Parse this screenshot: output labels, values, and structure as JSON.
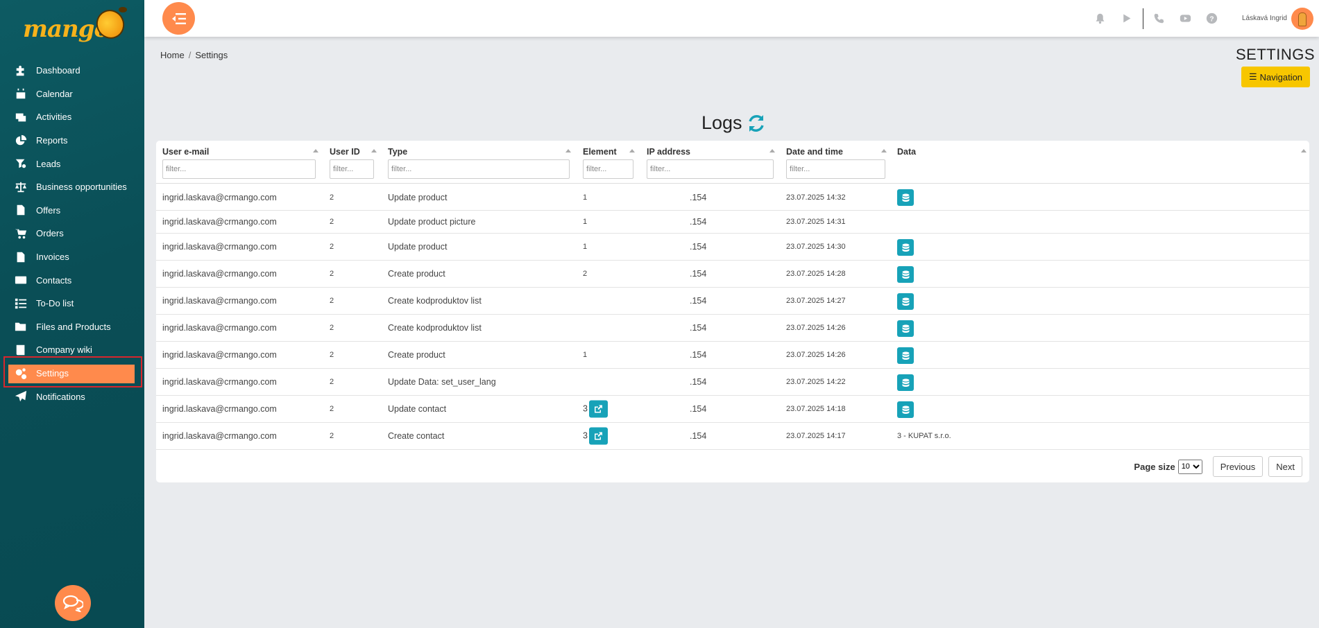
{
  "app": {
    "logo_text": "mango"
  },
  "sidebar": {
    "items": [
      {
        "label": "Dashboard",
        "icon": "puzzle-icon"
      },
      {
        "label": "Calendar",
        "icon": "calendar-icon"
      },
      {
        "label": "Activities",
        "icon": "activities-icon"
      },
      {
        "label": "Reports",
        "icon": "pie-chart-icon"
      },
      {
        "label": "Leads",
        "icon": "funnel-icon"
      },
      {
        "label": "Business opportunities",
        "icon": "scale-icon"
      },
      {
        "label": "Offers",
        "icon": "document-icon"
      },
      {
        "label": "Orders",
        "icon": "cart-icon"
      },
      {
        "label": "Invoices",
        "icon": "invoice-icon"
      },
      {
        "label": "Contacts",
        "icon": "contact-card-icon"
      },
      {
        "label": "To-Do list",
        "icon": "checklist-icon"
      },
      {
        "label": "Files and Products",
        "icon": "folder-icon"
      },
      {
        "label": "Company wiki",
        "icon": "book-icon"
      },
      {
        "label": "Settings",
        "icon": "gears-icon",
        "active": true
      },
      {
        "label": "Notifications",
        "icon": "paper-plane-icon"
      }
    ]
  },
  "topbar": {
    "user_name": "Láskavá Ingrid",
    "icons": [
      "bell-icon",
      "play-icon",
      "phone-icon",
      "youtube-icon",
      "help-icon"
    ]
  },
  "breadcrumb": {
    "home": "Home",
    "separator": "/",
    "current": "Settings"
  },
  "page": {
    "title": "SETTINGS",
    "navigation_button": "Navigation"
  },
  "logs": {
    "title": "Logs",
    "columns": {
      "email": "User e-mail",
      "user_id": "User ID",
      "type": "Type",
      "element": "Element",
      "ip": "IP address",
      "datetime": "Date and time",
      "data": "Data"
    },
    "filter_placeholder": "filter...",
    "rows": [
      {
        "email": "ingrid.laskava@crmango.com",
        "user_id": "2",
        "type": "Update product",
        "element": "1",
        "element_link": false,
        "ip": ".154",
        "datetime": "23.07.2025 14:32",
        "data": "",
        "data_button": true
      },
      {
        "email": "ingrid.laskava@crmango.com",
        "user_id": "2",
        "type": "Update product picture",
        "element": "1",
        "element_link": false,
        "ip": ".154",
        "datetime": "23.07.2025 14:31",
        "data": "",
        "data_button": false
      },
      {
        "email": "ingrid.laskava@crmango.com",
        "user_id": "2",
        "type": "Update product",
        "element": "1",
        "element_link": false,
        "ip": ".154",
        "datetime": "23.07.2025 14:30",
        "data": "",
        "data_button": true
      },
      {
        "email": "ingrid.laskava@crmango.com",
        "user_id": "2",
        "type": "Create product",
        "element": "2",
        "element_link": false,
        "ip": ".154",
        "datetime": "23.07.2025 14:28",
        "data": "",
        "data_button": true
      },
      {
        "email": "ingrid.laskava@crmango.com",
        "user_id": "2",
        "type": "Create kodproduktov list",
        "element": "",
        "element_link": false,
        "ip": ".154",
        "datetime": "23.07.2025 14:27",
        "data": "",
        "data_button": true
      },
      {
        "email": "ingrid.laskava@crmango.com",
        "user_id": "2",
        "type": "Create kodproduktov list",
        "element": "",
        "element_link": false,
        "ip": ".154",
        "datetime": "23.07.2025 14:26",
        "data": "",
        "data_button": true
      },
      {
        "email": "ingrid.laskava@crmango.com",
        "user_id": "2",
        "type": "Create product",
        "element": "1",
        "element_link": false,
        "ip": ".154",
        "datetime": "23.07.2025 14:26",
        "data": "",
        "data_button": true
      },
      {
        "email": "ingrid.laskava@crmango.com",
        "user_id": "2",
        "type": "Update Data: set_user_lang",
        "element": "",
        "element_link": false,
        "ip": ".154",
        "datetime": "23.07.2025 14:22",
        "data": "",
        "data_button": true
      },
      {
        "email": "ingrid.laskava@crmango.com",
        "user_id": "2",
        "type": "Update contact",
        "element": "3",
        "element_link": true,
        "ip": ".154",
        "datetime": "23.07.2025 14:18",
        "data": "",
        "data_button": true
      },
      {
        "email": "ingrid.laskava@crmango.com",
        "user_id": "2",
        "type": "Create contact",
        "element": "3",
        "element_link": true,
        "ip": ".154",
        "datetime": "23.07.2025 14:17",
        "data": "3 - KUPAT s.r.o.",
        "data_button": false
      }
    ]
  },
  "pagination": {
    "page_size_label": "Page size",
    "page_size": "10",
    "previous": "Previous",
    "next": "Next"
  },
  "colors": {
    "sidebar_bg": "#0a5058",
    "accent_orange": "#ff8a4c",
    "teal_button": "#17a2b8",
    "nav_button_yellow": "#f7c600"
  }
}
